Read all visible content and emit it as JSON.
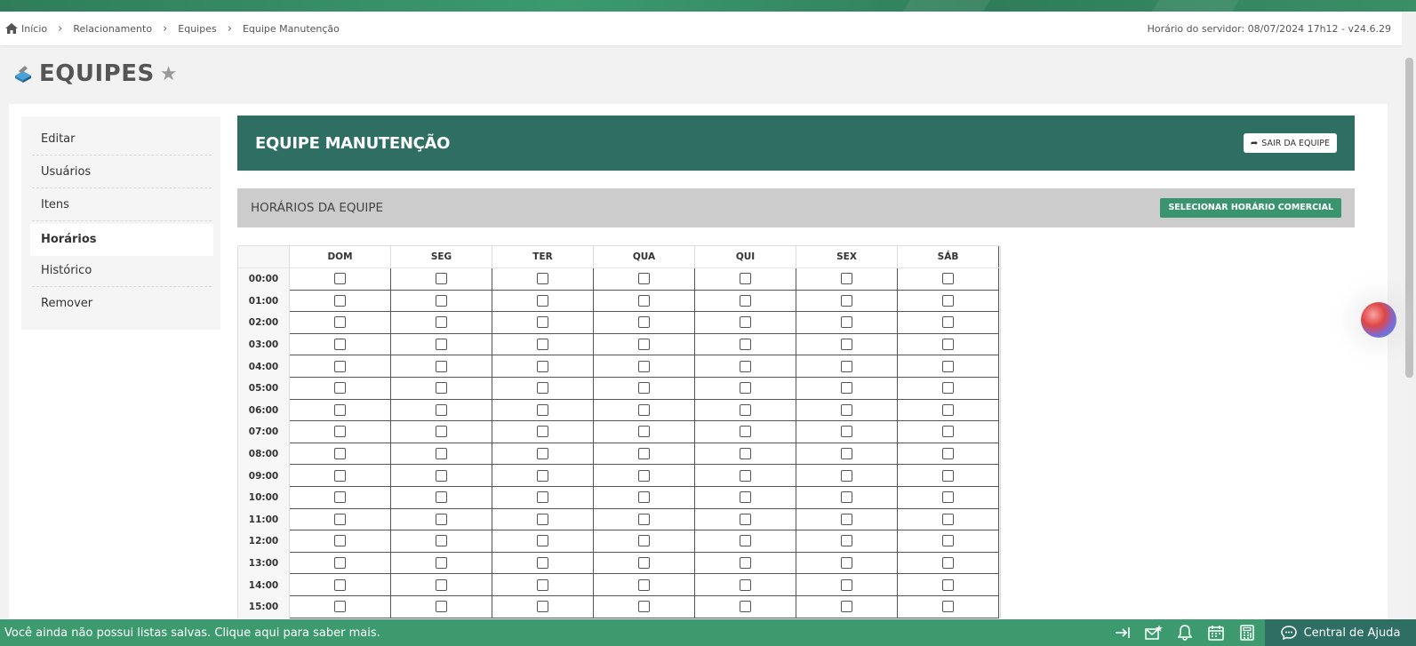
{
  "breadcrumb": {
    "items": [
      "Início",
      "Relacionamento",
      "Equipes",
      "Equipe Manutenção"
    ]
  },
  "server_time": "Horário do servidor: 08/07/2024 17h12 - v24.6.29",
  "page": {
    "title": "EQUIPES"
  },
  "side_menu": {
    "items": [
      "Editar",
      "Usuários",
      "Itens",
      "Horários",
      "Histórico",
      "Remover"
    ],
    "active": "Horários"
  },
  "team": {
    "name": "EQUIPE MANUTENÇÃO",
    "leave_label": "SAIR DA EQUIPE"
  },
  "schedule": {
    "title": "HORÁRIOS DA EQUIPE",
    "commercial_label": "SELECIONAR HORÁRIO COMERCIAL",
    "days": [
      "DOM",
      "SEG",
      "TER",
      "QUA",
      "QUI",
      "SEX",
      "SÁB"
    ],
    "hours": [
      "00:00",
      "01:00",
      "02:00",
      "03:00",
      "04:00",
      "05:00",
      "06:00",
      "07:00",
      "08:00",
      "09:00",
      "10:00",
      "11:00",
      "12:00",
      "13:00",
      "14:00",
      "15:00"
    ]
  },
  "footer": {
    "message": "Você ainda não possui listas salvas. Clique aqui para saber mais.",
    "help_label": "Central de Ajuda",
    "icons": [
      "sidebar-collapse-icon",
      "mail-star-icon",
      "bell-icon",
      "calendar-icon",
      "calculator-icon"
    ]
  },
  "colors": {
    "brand_green": "#3d9a6f",
    "header_teal": "#2e6e63",
    "bar_gray": "#cccccc"
  }
}
